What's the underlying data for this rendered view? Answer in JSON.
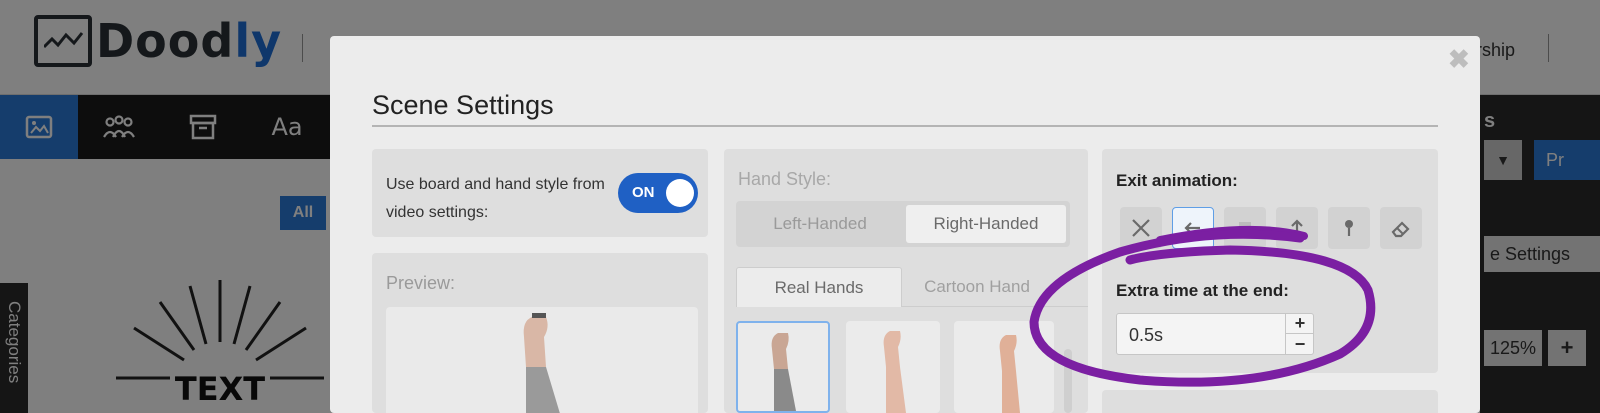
{
  "app": {
    "brand_prefix": "Dood",
    "brand_suffix": "ly",
    "header_link": "ership"
  },
  "toolbar": {
    "items": [
      "image-icon",
      "characters-icon",
      "props-icon",
      "text-icon"
    ],
    "text_tool_label": "Aa"
  },
  "left_panel": {
    "filter_label": "All",
    "categories_label": "Categories",
    "sketch_text": "TEXT"
  },
  "right_panel": {
    "title": "s",
    "dropdown_arrow": "▼",
    "blue_button": "Pr",
    "settings_label": "e Settings",
    "zoom_value": "125%",
    "zoom_plus": "+"
  },
  "modal": {
    "title": "Scene Settings",
    "close": "✖",
    "board_style": {
      "label": "Use board and hand style from video settings:",
      "toggle_label": "ON",
      "toggle_on": true
    },
    "preview_label": "Preview:",
    "hand_style": {
      "label": "Hand Style:",
      "options": [
        "Left-Handed",
        "Right-Handed"
      ],
      "selected": "Right-Handed",
      "tabs": [
        "Real Hands",
        "Cartoon Hand"
      ],
      "active_tab": "Real Hands"
    },
    "exit_animation": {
      "label": "Exit animation:",
      "options": [
        "none-icon",
        "swipe-left-icon",
        "fade-icon",
        "move-up-icon",
        "pin-icon",
        "eraser-icon"
      ],
      "selected_index": 1
    },
    "extra_time": {
      "label": "Extra time at the end:",
      "value": "0.5s",
      "increment": "+",
      "decrement": "−"
    }
  },
  "colors": {
    "accent": "#1f60c4",
    "highlight_stroke": "#7b1fa2",
    "overlay": "#000000"
  }
}
